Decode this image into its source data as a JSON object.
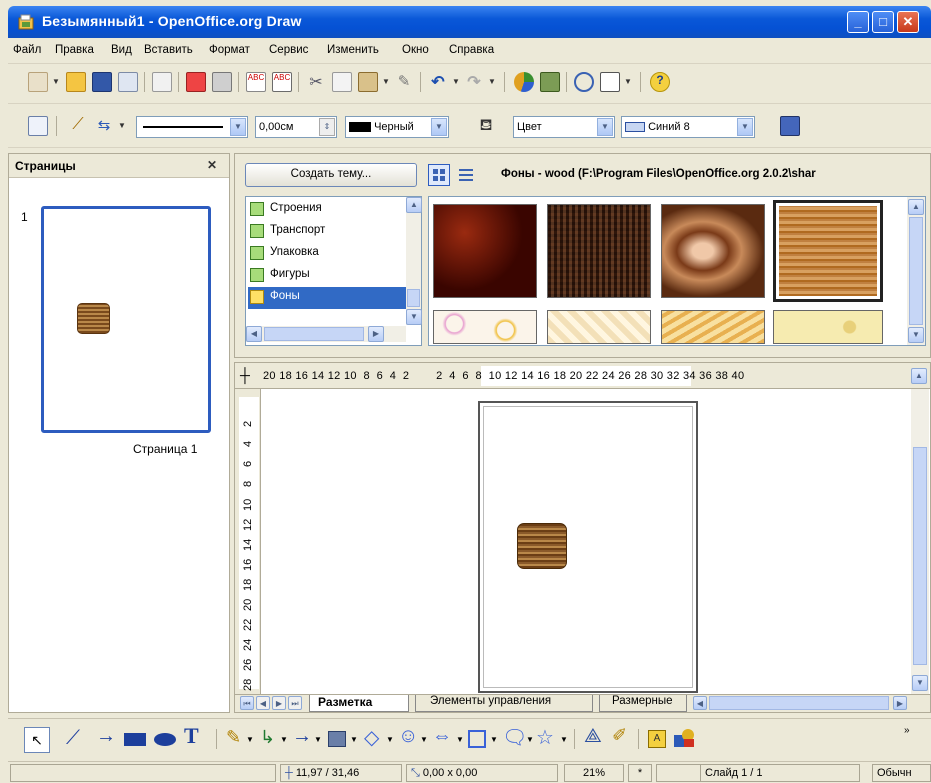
{
  "window": {
    "title": "Безымянный1 - OpenOffice.org Draw",
    "minimize": "_",
    "maximize": "□",
    "close": "✕"
  },
  "menu": [
    "Файл",
    "Правка",
    "Вид",
    "Вставить",
    "Формат",
    "Сервис",
    "Изменить",
    "Окно",
    "Справка"
  ],
  "line_toolbar": {
    "line_width": "0,00см",
    "line_color": "Черный",
    "area_style": "Цвет",
    "area_color": "Синий 8"
  },
  "pages_panel": {
    "title": "Страницы",
    "close": "✕",
    "page_number": "1",
    "page_label": "Страница 1"
  },
  "gallery": {
    "new_theme_button": "Создать тему...",
    "path": "Фоны - wood (F:\\Program Files\\OpenOffice.org 2.0.2\\shar",
    "themes": [
      "Строения",
      "Транспорт",
      "Упаковка",
      "Фигуры",
      "Фоны"
    ],
    "selected_theme": "Фоны"
  },
  "ruler": {
    "horizontal": "20 18 16 14 12 10  8  6  4  2        2  4  6  8  10 12 14 16 18 20 22 24 26 28 30 32 34 36 38 40",
    "vertical": [
      "2",
      "4",
      "6",
      "8",
      "10",
      "12",
      "14",
      "16",
      "18",
      "20",
      "22",
      "24",
      "26",
      "28"
    ]
  },
  "tabs": {
    "layout": "Разметка",
    "controls": "Элементы управления",
    "dimension": "Размерные"
  },
  "status": {
    "position": "11,97 / 31,46",
    "size": "0,00 x 0,00",
    "zoom": "21%",
    "modified": "*",
    "slide": "Слайд 1 / 1",
    "style": "Обычн"
  },
  "colors": {
    "title_blue": "#0a58d8",
    "selection": "#316ac5"
  }
}
